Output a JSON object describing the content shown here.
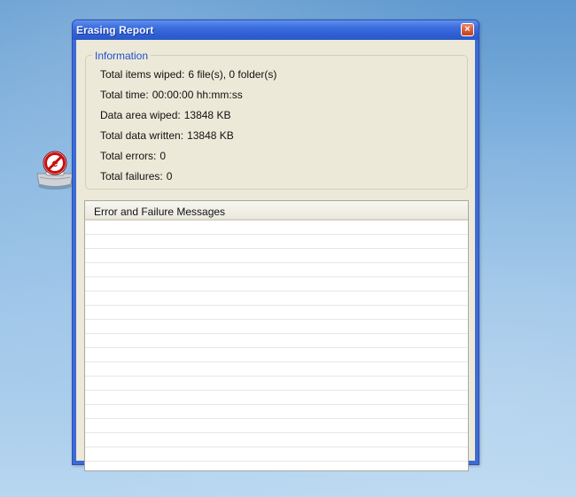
{
  "window": {
    "title": "Erasing Report",
    "close_label": "×"
  },
  "info": {
    "group_title": "Information",
    "rows": [
      {
        "label": "Total items wiped:",
        "value": "6 file(s), 0 folder(s)"
      },
      {
        "label": "Total time:",
        "value": "00:00:00  hh:mm:ss"
      },
      {
        "label": "Data area wiped:",
        "value": "13848 KB"
      },
      {
        "label": "Total data written:",
        "value": "13848 KB"
      },
      {
        "label": "Total errors:",
        "value": "0"
      },
      {
        "label": "Total failures:",
        "value": "0"
      }
    ]
  },
  "messages": {
    "column_header": "Error and Failure Messages"
  },
  "desktop": {
    "shortcut_icon": "eraser-app-icon"
  },
  "colors": {
    "titlebar": "#2f5fd3",
    "client_bg": "#ece9d8",
    "group_title": "#1f4ecf",
    "close_button": "#d85c37"
  }
}
